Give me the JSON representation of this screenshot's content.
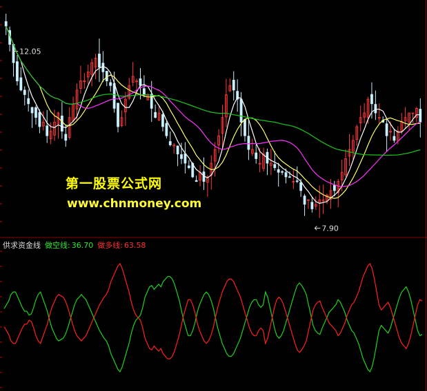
{
  "colors": {
    "background": "#000000",
    "frame": "#8b0000",
    "axis_tick": "#cc0000",
    "up_candle": "#ff3b3b",
    "down_candle": "#c8f0ff",
    "ma_fast": "#ffffff",
    "ma_mid": "#ffff66",
    "ma_slow": "#ff33ff",
    "ma_long": "#19c819",
    "short_line": "#1ed21e",
    "long_line": "#ff2020",
    "label_title": "#d8d8d8",
    "label_short": "#2ee62e",
    "label_long": "#ff3030",
    "watermark_cn": "#ffff00",
    "watermark_url": "#ffff33"
  },
  "watermark": {
    "line1": "第一股票公式网",
    "line2": "www.chnmoney.com"
  },
  "indicator": {
    "title": "供求资金线",
    "short_label": "做空线:",
    "short_value": "36.70",
    "long_label": "做多线:",
    "long_value": "63.58"
  },
  "chart_data": [
    {
      "type": "candlestick",
      "title": "",
      "annotations": [
        {
          "text": "12.05",
          "kind": "high_marker",
          "at_bar": 1
        },
        {
          "text": "7.90",
          "kind": "low_marker",
          "at_bar": 82
        }
      ],
      "ylim": [
        7.6,
        12.3
      ],
      "n_bars": 112,
      "close": [
        12.0,
        11.6,
        11.2,
        10.8,
        10.6,
        10.5,
        10.3,
        10.1,
        10.0,
        9.8,
        9.9,
        9.6,
        9.7,
        9.9,
        10.1,
        9.7,
        9.5,
        10.0,
        10.3,
        10.6,
        10.8,
        10.8,
        11.0,
        11.2,
        11.3,
        11.1,
        11.0,
        10.8,
        10.7,
        10.2,
        9.8,
        10.0,
        10.4,
        10.7,
        10.9,
        10.8,
        10.7,
        10.5,
        10.5,
        10.2,
        10.0,
        10.1,
        9.8,
        9.6,
        9.4,
        9.4,
        9.2,
        9.1,
        9.0,
        8.9,
        8.7,
        8.6,
        8.8,
        8.6,
        8.7,
        9.0,
        9.3,
        9.6,
        10.0,
        10.5,
        10.7,
        10.6,
        10.4,
        9.9,
        9.6,
        9.3,
        9.3,
        9.1,
        9.0,
        9.2,
        9.0,
        9.0,
        8.9,
        8.8,
        8.8,
        8.7,
        8.7,
        8.6,
        8.6,
        8.4,
        8.1,
        8.2,
        8.0,
        8.1,
        8.2,
        8.2,
        8.3,
        8.4,
        8.4,
        8.6,
        8.8,
        9.1,
        9.3,
        9.5,
        9.8,
        10.0,
        10.1,
        10.4,
        10.3,
        10.1,
        10.0,
        9.9,
        9.6,
        9.7,
        9.5,
        9.7,
        9.9,
        10.0,
        10.1,
        10.1,
        10.2,
        9.9
      ],
      "moving_averages": [
        "MA5",
        "MA10",
        "MA20",
        "MA60"
      ]
    },
    {
      "type": "line",
      "title": "供求资金线",
      "ylim": [
        0,
        100
      ],
      "series": [
        {
          "name": "做空线",
          "values": [
            57,
            60,
            63,
            68,
            70,
            70,
            66,
            62,
            58,
            55,
            55,
            52,
            53,
            58,
            64,
            68,
            70,
            65,
            60,
            55,
            48,
            42,
            38,
            34,
            32,
            33,
            34,
            37,
            42,
            48,
            54,
            60,
            64,
            66,
            68,
            66,
            64,
            60,
            56,
            52,
            48,
            44,
            40,
            37,
            34,
            32,
            28,
            22,
            18,
            14,
            10,
            8,
            12,
            18,
            24,
            30,
            38,
            44,
            48,
            50,
            52,
            58,
            66,
            70,
            74,
            75,
            72,
            74,
            76,
            74,
            78,
            80,
            82,
            82,
            80,
            76,
            70,
            64,
            56,
            48,
            42,
            36,
            36,
            40,
            46,
            54,
            60,
            64,
            68,
            70,
            68,
            64,
            58,
            50,
            42,
            36,
            30,
            26,
            22,
            20,
            20,
            22,
            26,
            30,
            34,
            40,
            46,
            52,
            58,
            62,
            64,
            64,
            60,
            58,
            60,
            70,
            66,
            58,
            50,
            42,
            36,
            34,
            36,
            40,
            46,
            52,
            58,
            64,
            70,
            75,
            77,
            75,
            72,
            68,
            60,
            52,
            44,
            40,
            38,
            37,
            42,
            46,
            50,
            54,
            56,
            58,
            60,
            64,
            62,
            58,
            54,
            48,
            44,
            40,
            38,
            34,
            30,
            24,
            18,
            14,
            10,
            8,
            12,
            20,
            30,
            40,
            44,
            42,
            40,
            38,
            42,
            48,
            54,
            60,
            66,
            70,
            72,
            74,
            70,
            64,
            56,
            48,
            40,
            36,
            37
          ]
        },
        {
          "name": "做多线",
          "values": [
            43,
            40,
            37,
            32,
            30,
            30,
            34,
            38,
            42,
            45,
            45,
            48,
            47,
            42,
            36,
            32,
            30,
            35,
            40,
            45,
            52,
            58,
            62,
            66,
            68,
            67,
            66,
            63,
            58,
            52,
            46,
            40,
            36,
            34,
            32,
            34,
            36,
            40,
            44,
            48,
            52,
            56,
            60,
            63,
            66,
            68,
            72,
            78,
            82,
            86,
            90,
            92,
            88,
            82,
            76,
            70,
            62,
            56,
            52,
            50,
            48,
            42,
            34,
            30,
            26,
            25,
            28,
            26,
            24,
            26,
            22,
            20,
            18,
            18,
            20,
            24,
            30,
            36,
            44,
            52,
            58,
            64,
            64,
            60,
            54,
            46,
            40,
            36,
            32,
            30,
            32,
            36,
            42,
            50,
            58,
            64,
            70,
            74,
            78,
            80,
            80,
            78,
            74,
            70,
            66,
            60,
            54,
            48,
            42,
            38,
            36,
            36,
            40,
            42,
            40,
            30,
            34,
            42,
            50,
            58,
            64,
            66,
            64,
            60,
            54,
            48,
            42,
            36,
            30,
            25,
            23,
            25,
            28,
            32,
            40,
            48,
            56,
            60,
            62,
            63,
            58,
            54,
            50,
            46,
            44,
            42,
            40,
            36,
            38,
            42,
            46,
            52,
            56,
            60,
            62,
            66,
            70,
            76,
            82,
            86,
            90,
            92,
            88,
            80,
            70,
            60,
            56,
            58,
            60,
            62,
            58,
            52,
            46,
            40,
            34,
            30,
            28,
            26,
            30,
            36,
            44,
            52,
            60,
            64,
            63
          ]
        }
      ]
    }
  ]
}
